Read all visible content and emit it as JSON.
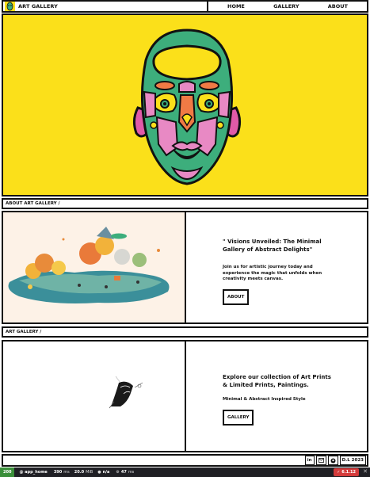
{
  "nav": {
    "brand": "ART GALLERY",
    "links": [
      "HOME",
      "GALLERY",
      "ABOUT"
    ]
  },
  "about_section": {
    "heading": "ABOUT ART GALLERY /",
    "title": "\" Visions Unveiled: The Minimal Gallery of Abstract Delights\"",
    "description": "Join us for artistic journey today and experience the magic that unfolds when creativity meets canvas.",
    "button": "ABOUT"
  },
  "gallery_section": {
    "heading": "ART GALLERY /",
    "title": "Explore our collection of Art Prints & Limited Prints, Paintings.",
    "description": "Minimal & Abstract Inspired Style",
    "button": "GALLERY"
  },
  "footer": {
    "icons": [
      "linkedin-icon",
      "mail-icon",
      "github-icon"
    ],
    "linkedin_label": "in",
    "credit": "D.L 2023"
  },
  "status_bar": {
    "code": "200",
    "route": "@ app_home",
    "time": "390",
    "time_unit": "ms",
    "memory": "20.0",
    "memory_unit": "MiB",
    "user": "n/a",
    "render": "47",
    "render_unit": "ms",
    "version": "6.1.12"
  },
  "colors": {
    "hero_bg": "#fbe01a",
    "face_green": "#3dae7c",
    "face_pink": "#e889c4",
    "face_orange": "#f07a45",
    "status_bg": "#1f1f24",
    "status_ok": "#3a8f3a",
    "version_badge": "#d43b3b"
  }
}
